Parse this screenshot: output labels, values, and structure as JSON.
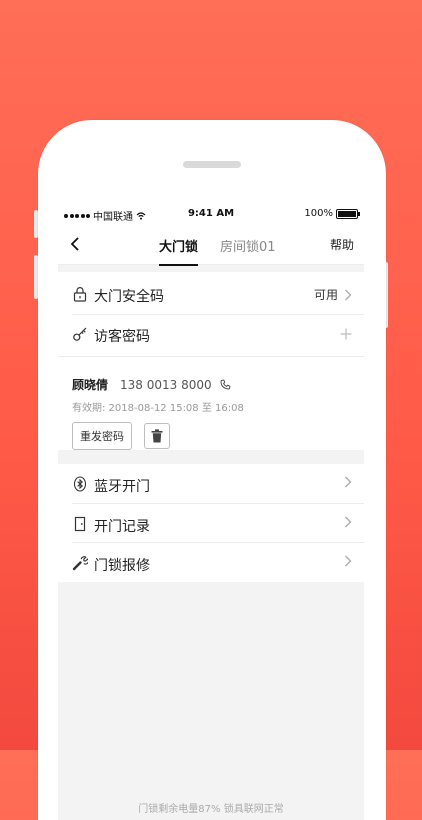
{
  "status_bar": {
    "carrier": "中国联通",
    "time": "9:41 AM",
    "battery": "100%"
  },
  "nav": {
    "tabs": [
      "大门锁",
      "房间锁01"
    ],
    "active_tab": 0,
    "help": "帮助"
  },
  "security": {
    "gate_code_label": "大门安全码",
    "gate_code_status": "可用",
    "visitor_code_label": "访客密码"
  },
  "visitor": {
    "name": "顾晓倩",
    "phone": "138 0013 8000",
    "validity": "有效期: 2018-08-12 15:08 至 16:08",
    "resend_label": "重发密码"
  },
  "menu": {
    "items": [
      "蓝牙开门",
      "开门记录",
      "门锁报修"
    ]
  },
  "footer": {
    "text": "门锁剩余电量87%  锁具联网正常"
  }
}
